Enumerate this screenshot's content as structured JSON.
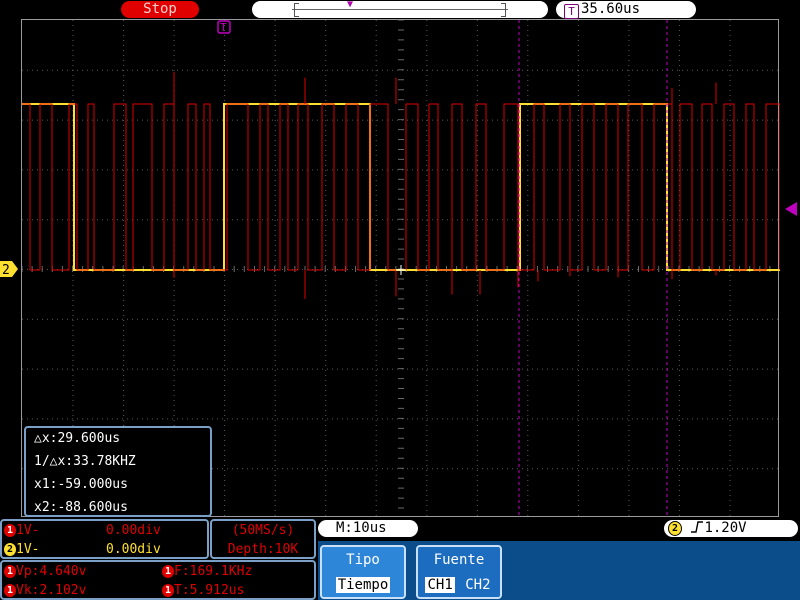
{
  "top": {
    "run_state": "Stop",
    "trigger_position": "35.60us",
    "trigger_icon": "T"
  },
  "colors": {
    "ch1": "#e00000",
    "ch2": "#ffe030",
    "cursor": "#c000c0",
    "grid": "#5a5a5a",
    "panel_border": "#7aa0c8",
    "menu_bg": "#0a4d8a",
    "menu_button": "#2e86d8"
  },
  "markers": {
    "ch2_label": "2"
  },
  "cursor_panel": {
    "delta_x": "△x:29.600us",
    "inv_delta_x": "1/△x:33.78KHZ",
    "x1": "x1:-59.000us",
    "x2": "x2:-88.600us"
  },
  "channels": {
    "ch1": {
      "badge": "1",
      "scale": "1V-",
      "offset": "0.00div"
    },
    "ch2": {
      "badge": "2",
      "scale": "1V-",
      "offset": "0.00div"
    }
  },
  "acquisition": {
    "sample_rate": "(50MS/s)",
    "depth": "Depth:10K"
  },
  "measurements": {
    "vp": "Vp:4.640v",
    "vk": "Vk:2.102v",
    "freq": "F:169.1KHz",
    "period": "T:5.912us"
  },
  "timebase": "M:10us",
  "trigger": {
    "channel": "2",
    "edge_icon": "rising-edge-icon",
    "level": "1.20V"
  },
  "menu": {
    "tipo": {
      "title": "Tipo",
      "selected": "Tiempo"
    },
    "fuente": {
      "title": "Fuente",
      "option1": "CH1",
      "option2": "CH2",
      "selected": "CH1"
    }
  }
}
